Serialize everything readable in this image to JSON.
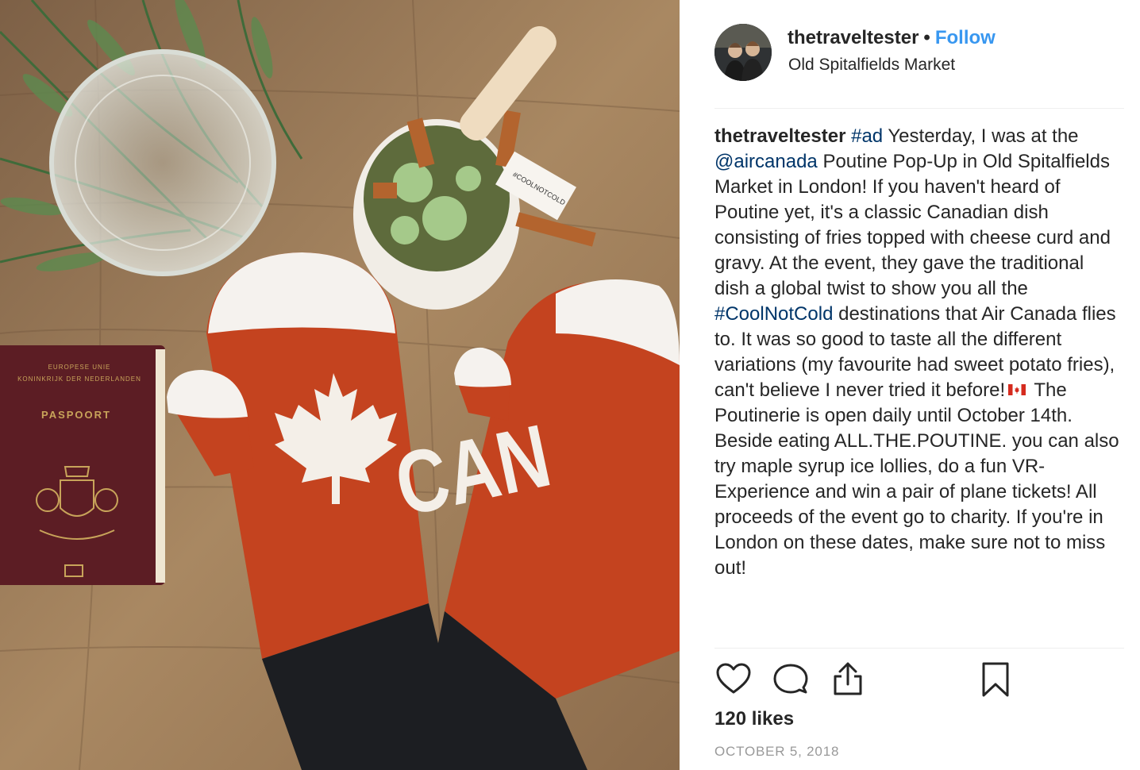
{
  "post": {
    "username": "thetraveltester",
    "separator": "•",
    "follow_label": "Follow",
    "location": "Old Spitalfields Market"
  },
  "photo": {
    "passport": {
      "line1": "EUROPESE UNIE",
      "line2": "KONINKRIJK DER NEDERLANDEN",
      "title": "PASPOORT"
    },
    "mitten_text": "CAN",
    "bowl_flag_text": "#COOLNOTCOLD"
  },
  "caption": {
    "username": "thetraveltester",
    "tag_ad": "#ad",
    "text_1": " Yesterday, I was at the ",
    "mention": "@aircanada",
    "text_2": " Poutine Pop-Up in Old Spitalfields Market in London! If you haven't heard of Poutine yet, it's a classic Canadian dish consisting of fries topped with cheese curd and gravy. At the event, they gave the traditional dish a global twist to show you all the ",
    "tag_cool": "#CoolNotCold",
    "text_3": " destinations that Air Canada flies to. It was so good to taste all the different variations (my favourite had sweet potato fries), can't believe I never tried it before!",
    "text_4": " The Poutinerie is open daily until October 14th. Beside eating ALL.THE.POUTINE. you can also try maple syrup ice lollies, do a fun VR-Experience and win a pair of plane tickets! All proceeds of the event go to charity. If you're in London on these dates, make sure not to miss out!"
  },
  "actions": {
    "icons": [
      "heart-icon",
      "comment-icon",
      "share-icon",
      "bookmark-icon"
    ]
  },
  "likes": "120 likes",
  "date": "OCTOBER 5, 2018",
  "colors": {
    "link": "#3897f0",
    "hashtag": "#003569",
    "text": "#262626",
    "muted": "#999999"
  }
}
